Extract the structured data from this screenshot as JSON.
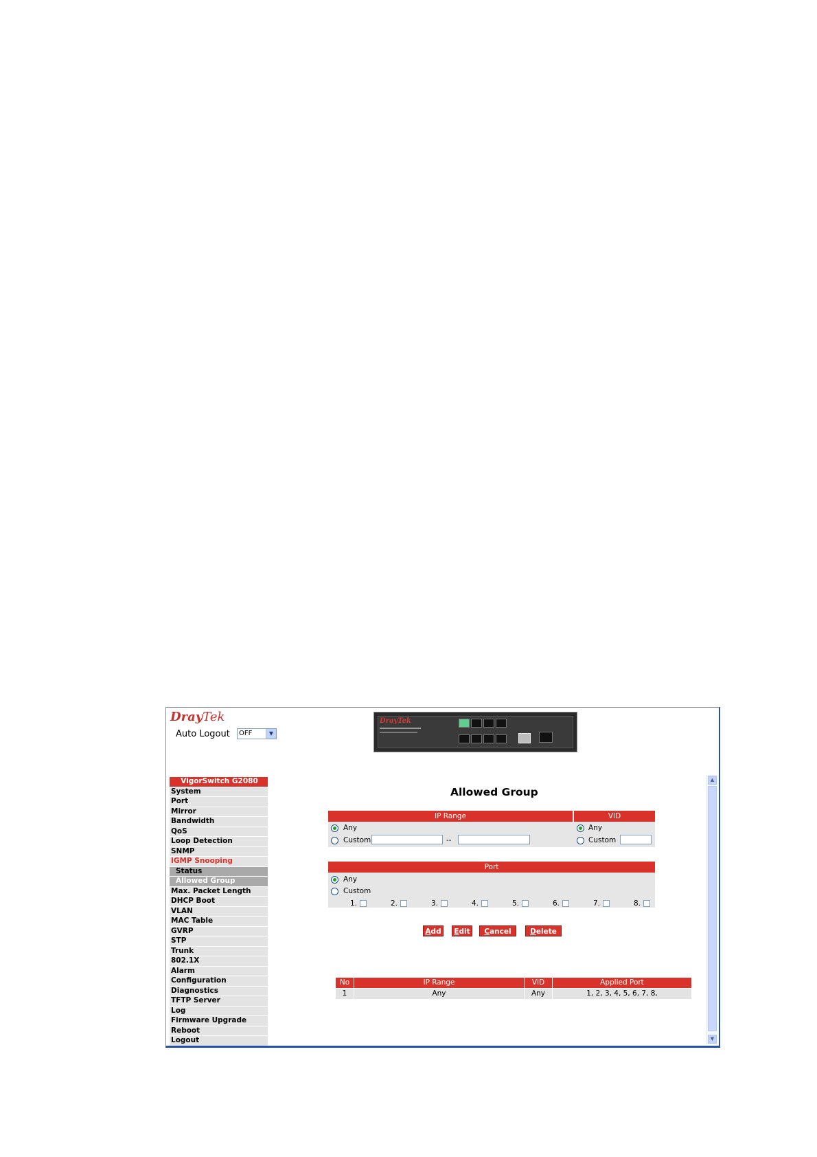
{
  "header": {
    "logo_dray": "Dray",
    "logo_tek": "Tek",
    "auto_logout_label": "Auto Logout",
    "auto_logout_value": "OFF",
    "device_brand": "DrayTek"
  },
  "sidebar": {
    "title": "VigorSwitch G2080",
    "items": [
      {
        "label": "System"
      },
      {
        "label": "Port"
      },
      {
        "label": "Mirror"
      },
      {
        "label": "Bandwidth"
      },
      {
        "label": "QoS"
      },
      {
        "label": "Loop Detection"
      },
      {
        "label": "SNMP"
      },
      {
        "label": "IGMP Snooping",
        "state": "active"
      },
      {
        "label": "Status",
        "state": "sub"
      },
      {
        "label": "Allowed Group",
        "state": "subsel"
      },
      {
        "label": "Max. Packet Length"
      },
      {
        "label": "DHCP Boot"
      },
      {
        "label": "VLAN"
      },
      {
        "label": "MAC Table"
      },
      {
        "label": "GVRP"
      },
      {
        "label": "STP"
      },
      {
        "label": "Trunk"
      },
      {
        "label": "802.1X"
      },
      {
        "label": "Alarm"
      },
      {
        "label": "Configuration"
      },
      {
        "label": "Diagnostics"
      },
      {
        "label": "TFTP Server"
      },
      {
        "label": "Log"
      },
      {
        "label": "Firmware Upgrade"
      },
      {
        "label": "Reboot"
      },
      {
        "label": "Logout"
      }
    ]
  },
  "main": {
    "title": "Allowed Group",
    "ip_range": {
      "header": "IP Range",
      "any_label": "Any",
      "custom_label": "Custom",
      "separator": "--",
      "selected": "Any"
    },
    "vid": {
      "header": "VID",
      "any_label": "Any",
      "custom_label": "Custom",
      "selected": "Any"
    },
    "port": {
      "header": "Port",
      "any_label": "Any",
      "custom_label": "Custom",
      "selected": "Any",
      "ports": [
        "1.",
        "2.",
        "3.",
        "4.",
        "5.",
        "6.",
        "7.",
        "8."
      ]
    },
    "buttons": {
      "add": {
        "first": "A",
        "rest": "dd"
      },
      "edit": {
        "first": "E",
        "rest": "dit"
      },
      "cancel": {
        "first": "C",
        "rest": "ancel"
      },
      "delete": {
        "first": "D",
        "rest": "elete"
      }
    },
    "table": {
      "headers": [
        "No",
        "IP Range",
        "VID",
        "Applied Port"
      ],
      "rows": [
        [
          "1",
          "Any",
          "Any",
          "1, 2, 3, 4, 5, 6, 7, 8,"
        ]
      ]
    }
  }
}
